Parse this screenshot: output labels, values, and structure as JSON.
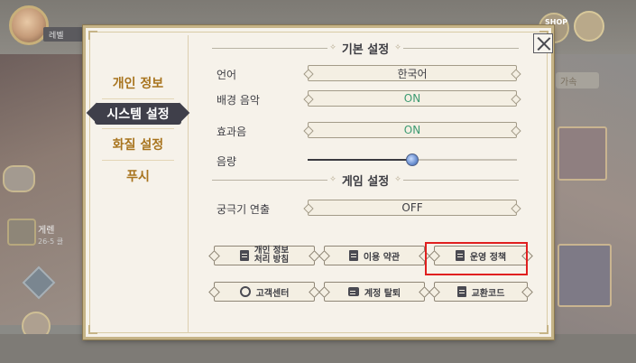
{
  "background": {
    "player_name_partial": "레벨",
    "speed_label_partial": "가속",
    "shop_label": "SHOP",
    "character_name_partial": "게렌",
    "character_sub_partial": "26-5 클"
  },
  "dialog": {
    "nav": [
      {
        "label": "개인 정보",
        "active": false
      },
      {
        "label": "시스템 설정",
        "active": true
      },
      {
        "label": "화질 설정",
        "active": false
      },
      {
        "label": "푸시",
        "active": false
      }
    ],
    "basic_section_title": "기본 설정",
    "language_label": "언어",
    "language_value": "한국어",
    "bgm_label": "배경 음악",
    "bgm_value": "ON",
    "sfx_label": "효과음",
    "sfx_value": "ON",
    "volume_label": "음량",
    "volume_level": 0.5,
    "game_section_title": "게임 설정",
    "ultimate_label": "궁극기 연출",
    "ultimate_value": "OFF",
    "buttons": {
      "privacy_line1": "개인 정보",
      "privacy_line2": "처리 방침",
      "terms": "이용 약관",
      "policy": "운영 정책",
      "support": "고객센터",
      "withdraw": "계정 탈퇴",
      "redeem": "교환코드"
    }
  },
  "colors": {
    "nav_text": "#a8741e",
    "nav_active_bg": "#3f3f4a",
    "on_text": "#3d9b72",
    "highlight": "#e01f1f"
  }
}
